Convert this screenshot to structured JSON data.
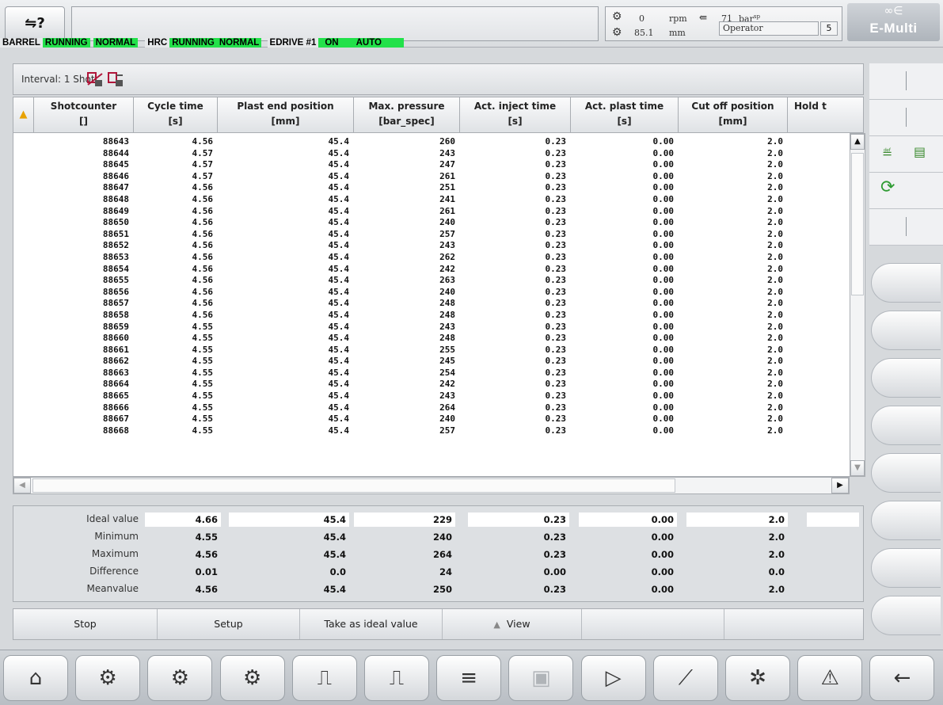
{
  "header": {
    "login_icon": "login-key-icon",
    "status": [
      {
        "label": "BARREL",
        "values": [
          "RUNNING",
          "NORMAL"
        ]
      },
      {
        "label": "HRC",
        "values": [
          "RUNNING",
          "NORMAL"
        ]
      },
      {
        "label": "EDRIVE #1",
        "values": [
          "ON",
          "AUTO"
        ]
      }
    ],
    "gauges": {
      "screw_speed": "0",
      "screw_speed_unit": "rpm",
      "screw_position": "85.1",
      "screw_position_unit": "mm",
      "pressure": "71",
      "pressure_unit": "bar",
      "pressure_unit_sup": "sp",
      "operator": "Operator",
      "level": "5"
    },
    "logo": "E-Multi",
    "colors": {
      "status_green": "#22e14a"
    }
  },
  "interval": {
    "label": "Interval:  1 Shot",
    "icons": [
      "sample-stop-icon",
      "sample-start-icon"
    ]
  },
  "table": {
    "columns": [
      {
        "title": "Shotcounter",
        "unit": "[]"
      },
      {
        "title": "Cycle time",
        "unit": "[s]"
      },
      {
        "title": "Plast end position",
        "unit": "[mm]"
      },
      {
        "title": "Max. pressure",
        "unit": "[bar_spec]"
      },
      {
        "title": "Act. inject time",
        "unit": "[s]"
      },
      {
        "title": "Act. plast time",
        "unit": "[s]"
      },
      {
        "title": "Cut off position",
        "unit": "[mm]"
      },
      {
        "title": "Hold t",
        "unit": ""
      }
    ],
    "rows": [
      [
        "88643",
        "4.56",
        "45.4",
        "260",
        "0.23",
        "0.00",
        "2.0"
      ],
      [
        "88644",
        "4.57",
        "45.4",
        "243",
        "0.23",
        "0.00",
        "2.0"
      ],
      [
        "88645",
        "4.57",
        "45.4",
        "247",
        "0.23",
        "0.00",
        "2.0"
      ],
      [
        "88646",
        "4.57",
        "45.4",
        "261",
        "0.23",
        "0.00",
        "2.0"
      ],
      [
        "88647",
        "4.56",
        "45.4",
        "251",
        "0.23",
        "0.00",
        "2.0"
      ],
      [
        "88648",
        "4.56",
        "45.4",
        "241",
        "0.23",
        "0.00",
        "2.0"
      ],
      [
        "88649",
        "4.56",
        "45.4",
        "261",
        "0.23",
        "0.00",
        "2.0"
      ],
      [
        "88650",
        "4.56",
        "45.4",
        "240",
        "0.23",
        "0.00",
        "2.0"
      ],
      [
        "88651",
        "4.56",
        "45.4",
        "257",
        "0.23",
        "0.00",
        "2.0"
      ],
      [
        "88652",
        "4.56",
        "45.4",
        "243",
        "0.23",
        "0.00",
        "2.0"
      ],
      [
        "88653",
        "4.56",
        "45.4",
        "262",
        "0.23",
        "0.00",
        "2.0"
      ],
      [
        "88654",
        "4.56",
        "45.4",
        "242",
        "0.23",
        "0.00",
        "2.0"
      ],
      [
        "88655",
        "4.56",
        "45.4",
        "263",
        "0.23",
        "0.00",
        "2.0"
      ],
      [
        "88656",
        "4.56",
        "45.4",
        "240",
        "0.23",
        "0.00",
        "2.0"
      ],
      [
        "88657",
        "4.56",
        "45.4",
        "248",
        "0.23",
        "0.00",
        "2.0"
      ],
      [
        "88658",
        "4.56",
        "45.4",
        "248",
        "0.23",
        "0.00",
        "2.0"
      ],
      [
        "88659",
        "4.55",
        "45.4",
        "243",
        "0.23",
        "0.00",
        "2.0"
      ],
      [
        "88660",
        "4.55",
        "45.4",
        "248",
        "0.23",
        "0.00",
        "2.0"
      ],
      [
        "88661",
        "4.55",
        "45.4",
        "255",
        "0.23",
        "0.00",
        "2.0"
      ],
      [
        "88662",
        "4.55",
        "45.4",
        "245",
        "0.23",
        "0.00",
        "2.0"
      ],
      [
        "88663",
        "4.55",
        "45.4",
        "254",
        "0.23",
        "0.00",
        "2.0"
      ],
      [
        "88664",
        "4.55",
        "45.4",
        "242",
        "0.23",
        "0.00",
        "2.0"
      ],
      [
        "88665",
        "4.55",
        "45.4",
        "243",
        "0.23",
        "0.00",
        "2.0"
      ],
      [
        "88666",
        "4.55",
        "45.4",
        "264",
        "0.23",
        "0.00",
        "2.0"
      ],
      [
        "88667",
        "4.55",
        "45.4",
        "240",
        "0.23",
        "0.00",
        "2.0"
      ],
      [
        "88668",
        "4.55",
        "45.4",
        "257",
        "0.23",
        "0.00",
        "2.0"
      ]
    ]
  },
  "stats": [
    {
      "label": "Ideal value",
      "values": [
        "4.66",
        "45.4",
        "229",
        "0.23",
        "0.00",
        "2.0"
      ]
    },
    {
      "label": "Minimum",
      "values": [
        "4.55",
        "45.4",
        "240",
        "0.23",
        "0.00",
        "2.0"
      ]
    },
    {
      "label": "Maximum",
      "values": [
        "4.56",
        "45.4",
        "264",
        "0.23",
        "0.00",
        "2.0"
      ]
    },
    {
      "label": "Difference",
      "values": [
        "0.01",
        "0.0",
        "24",
        "0.00",
        "0.00",
        "0.0"
      ]
    },
    {
      "label": "Meanvalue",
      "values": [
        "4.56",
        "45.4",
        "250",
        "0.23",
        "0.00",
        "2.0"
      ]
    }
  ],
  "commands": {
    "stop": "Stop",
    "setup": "Setup",
    "take_ideal": "Take as ideal value",
    "view": "View"
  },
  "right_panel": {
    "icons": [
      "heating-zones-icon",
      "oil-tank-icon",
      "cycle-recycle-icon"
    ]
  },
  "bottom_nav": [
    {
      "icon": "home-icon",
      "glyph": "⌂",
      "enabled": true
    },
    {
      "icon": "injection-unit-icon",
      "glyph": "⚙",
      "enabled": true
    },
    {
      "icon": "barrel-heating-icon",
      "glyph": "⚙",
      "enabled": true
    },
    {
      "icon": "nozzle-icon",
      "glyph": "⚙",
      "enabled": true
    },
    {
      "icon": "hot-runner-icon",
      "glyph": "⎍",
      "enabled": true
    },
    {
      "icon": "temperature-process-icon",
      "glyph": "⎍",
      "enabled": true
    },
    {
      "icon": "list-icon",
      "glyph": "≡",
      "enabled": true
    },
    {
      "icon": "mold-icon",
      "glyph": "▣",
      "enabled": false
    },
    {
      "icon": "ejector-icon",
      "glyph": "▷",
      "enabled": true
    },
    {
      "icon": "quality-chart-icon",
      "glyph": "⟋",
      "enabled": true
    },
    {
      "icon": "settings-icon",
      "glyph": "✲",
      "enabled": true
    },
    {
      "icon": "alarm-icon",
      "glyph": "⚠",
      "enabled": true
    },
    {
      "icon": "back-arrow-icon",
      "glyph": "←",
      "enabled": true
    }
  ]
}
